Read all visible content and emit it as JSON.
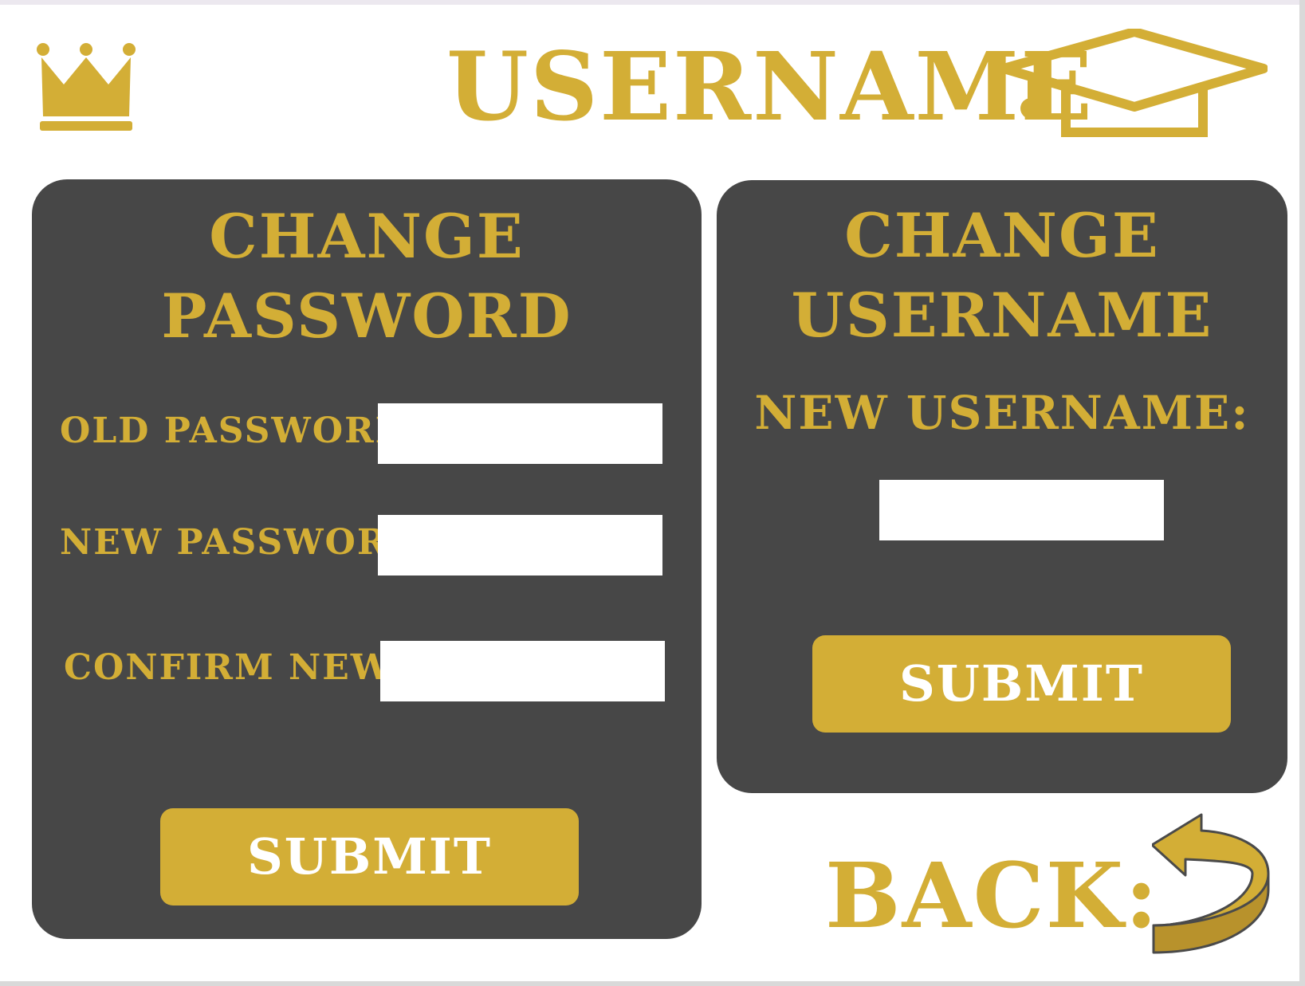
{
  "header": {
    "title": "USERNAME",
    "crown_icon": "crown-icon",
    "cap_icon": "graduation-cap-icon"
  },
  "password_panel": {
    "title_line1": "CHANGE",
    "title_line2": "PASSWORD",
    "fields": [
      {
        "label": "OLD PASSWORD:",
        "value": "",
        "placeholder": ""
      },
      {
        "label": "NEW PASSWORD:",
        "value": "",
        "placeholder": ""
      },
      {
        "label": "CONFIRM NEW:",
        "value": "",
        "placeholder": ""
      }
    ],
    "submit_label": "SUBMIT"
  },
  "username_panel": {
    "title_line1": "CHANGE",
    "title_line2": "USERNAME",
    "field": {
      "label": "NEW USERNAME:",
      "value": "",
      "placeholder": ""
    },
    "submit_label": "SUBMIT"
  },
  "back": {
    "label": "BACK:",
    "icon": "back-arrow-icon"
  },
  "colors": {
    "accent": "#d3ae36",
    "panel": "#474747",
    "background": "#ffffff"
  }
}
